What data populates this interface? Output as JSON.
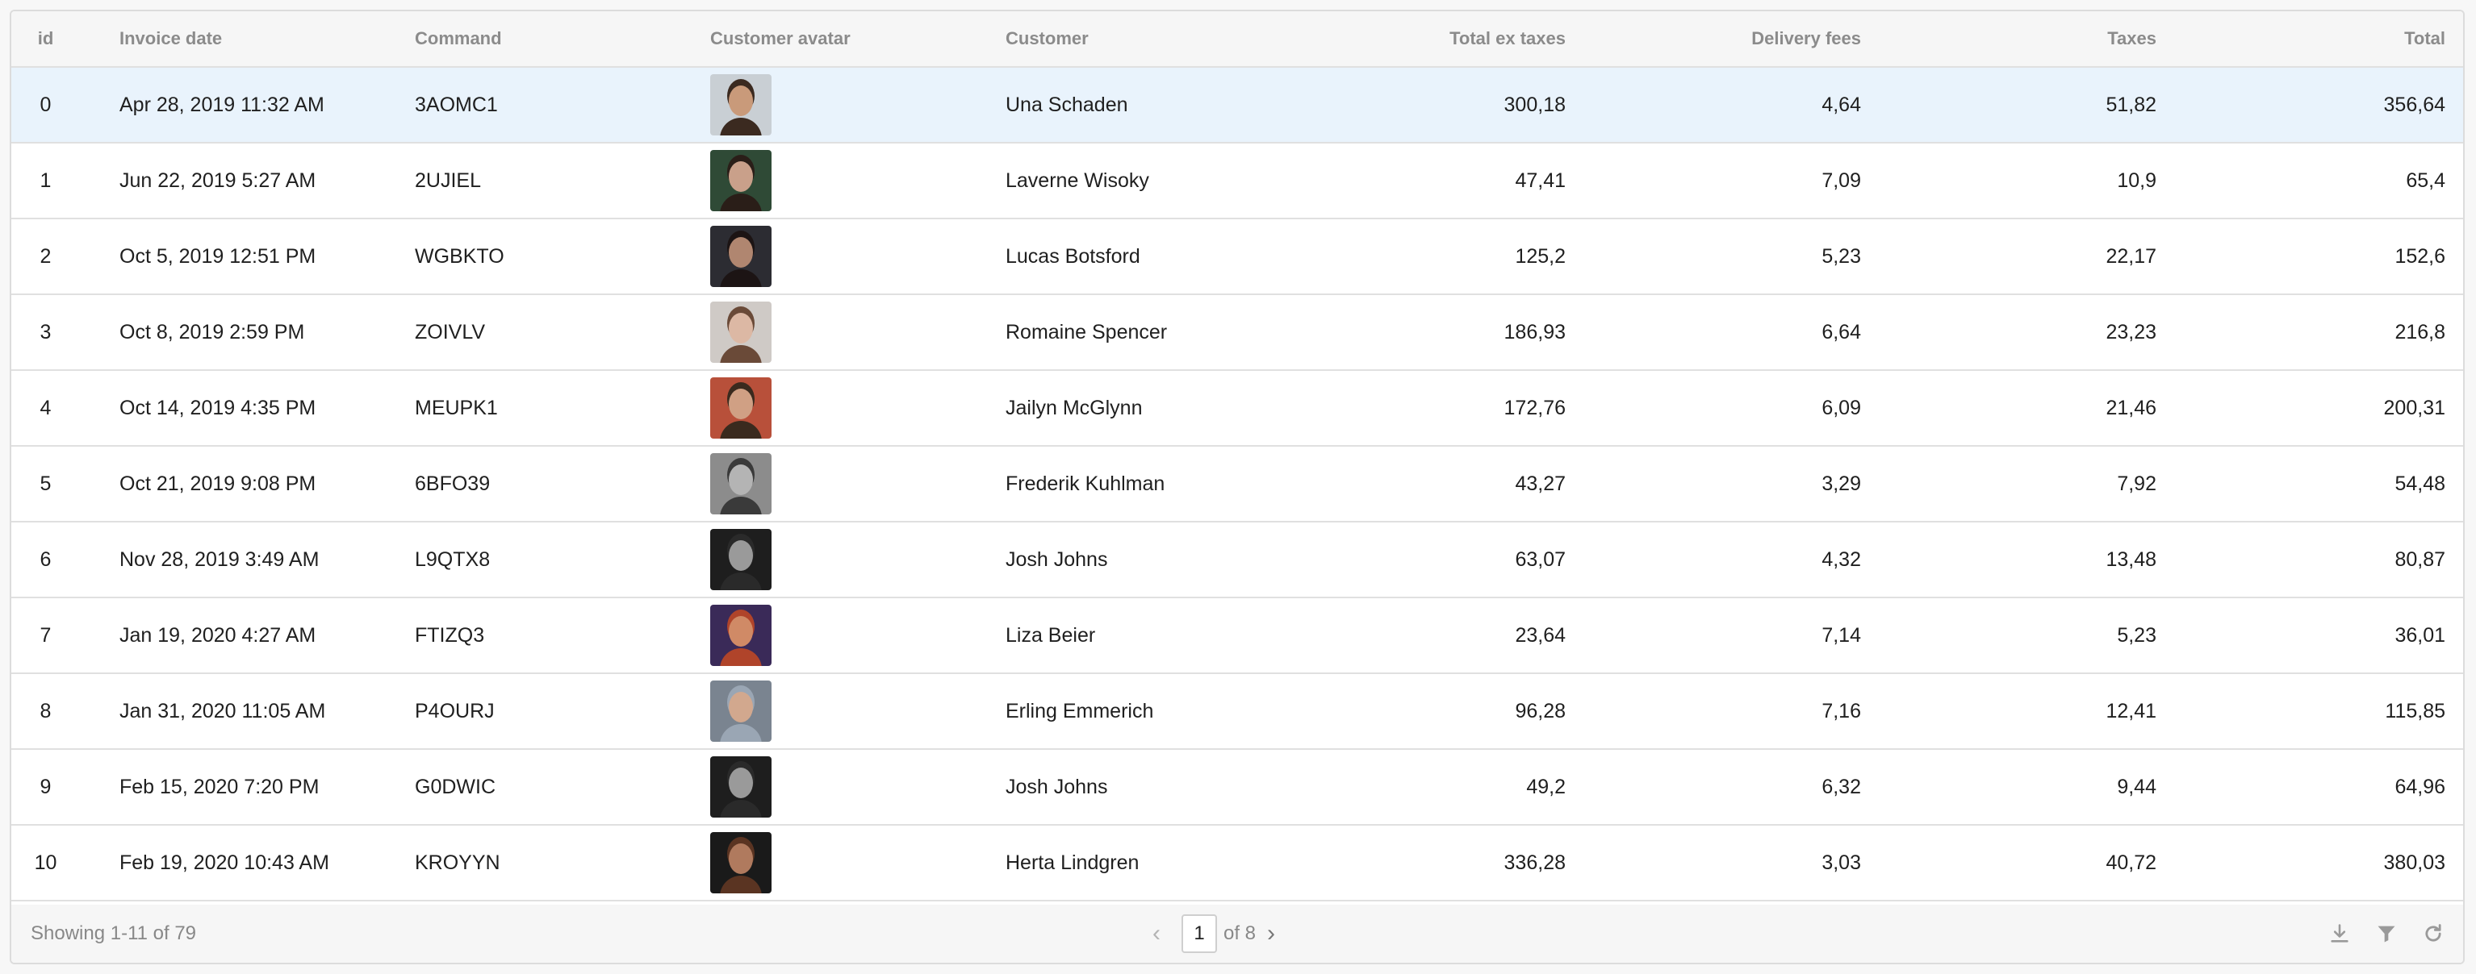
{
  "columns": {
    "id": "id",
    "invoice_date": "Invoice date",
    "command": "Command",
    "avatar": "Customer avatar",
    "customer": "Customer",
    "total_ex_taxes": "Total ex taxes",
    "delivery_fees": "Delivery fees",
    "taxes": "Taxes",
    "total": "Total"
  },
  "rows": [
    {
      "id": "0",
      "date": "Apr 28, 2019 11:32 AM",
      "command": "3AOMC1",
      "customer": "Una Schaden",
      "total_ex_taxes": "300,18",
      "delivery_fees": "4,64",
      "taxes": "51,82",
      "total": "356,64",
      "avatar_bg": "#c9cfd4",
      "avatar_skin": "#c99a7a",
      "avatar_hair": "#3b2a20"
    },
    {
      "id": "1",
      "date": "Jun 22, 2019 5:27 AM",
      "command": "2UJIEL",
      "customer": "Laverne Wisoky",
      "total_ex_taxes": "47,41",
      "delivery_fees": "7,09",
      "taxes": "10,9",
      "total": "65,4",
      "avatar_bg": "#2f4a36",
      "avatar_skin": "#c9a08a",
      "avatar_hair": "#2a1e18"
    },
    {
      "id": "2",
      "date": "Oct 5, 2019 12:51 PM",
      "command": "WGBKTO",
      "customer": "Lucas Botsford",
      "total_ex_taxes": "125,2",
      "delivery_fees": "5,23",
      "taxes": "22,17",
      "total": "152,6",
      "avatar_bg": "#2c2c32",
      "avatar_skin": "#b08670",
      "avatar_hair": "#1c1414"
    },
    {
      "id": "3",
      "date": "Oct 8, 2019 2:59 PM",
      "command": "ZOIVLV",
      "customer": "Romaine Spencer",
      "total_ex_taxes": "186,93",
      "delivery_fees": "6,64",
      "taxes": "23,23",
      "total": "216,8",
      "avatar_bg": "#cfcac6",
      "avatar_skin": "#dcb8a4",
      "avatar_hair": "#6a4a38"
    },
    {
      "id": "4",
      "date": "Oct 14, 2019 4:35 PM",
      "command": "MEUPK1",
      "customer": "Jailyn McGlynn",
      "total_ex_taxes": "172,76",
      "delivery_fees": "6,09",
      "taxes": "21,46",
      "total": "200,31",
      "avatar_bg": "#b8503a",
      "avatar_skin": "#d0a084",
      "avatar_hair": "#3a2a1e"
    },
    {
      "id": "5",
      "date": "Oct 21, 2019 9:08 PM",
      "command": "6BFO39",
      "customer": "Frederik Kuhlman",
      "total_ex_taxes": "43,27",
      "delivery_fees": "3,29",
      "taxes": "7,92",
      "total": "54,48",
      "avatar_bg": "#8c8c8c",
      "avatar_skin": "#b4b4b4",
      "avatar_hair": "#3a3a3a"
    },
    {
      "id": "6",
      "date": "Nov 28, 2019 3:49 AM",
      "command": "L9QTX8",
      "customer": "Josh Johns",
      "total_ex_taxes": "63,07",
      "delivery_fees": "4,32",
      "taxes": "13,48",
      "total": "80,87",
      "avatar_bg": "#1e1e1e",
      "avatar_skin": "#9a9a9a",
      "avatar_hair": "#2a2a2a"
    },
    {
      "id": "7",
      "date": "Jan 19, 2020 4:27 AM",
      "command": "FTIZQ3",
      "customer": "Liza Beier",
      "total_ex_taxes": "23,64",
      "delivery_fees": "7,14",
      "taxes": "5,23",
      "total": "36,01",
      "avatar_bg": "#3a2a58",
      "avatar_skin": "#d08a66",
      "avatar_hair": "#b0442a"
    },
    {
      "id": "8",
      "date": "Jan 31, 2020 11:05 AM",
      "command": "P4OURJ",
      "customer": "Erling Emmerich",
      "total_ex_taxes": "96,28",
      "delivery_fees": "7,16",
      "taxes": "12,41",
      "total": "115,85",
      "avatar_bg": "#7a8490",
      "avatar_skin": "#d2a88e",
      "avatar_hair": "#9aa6b4"
    },
    {
      "id": "9",
      "date": "Feb 15, 2020 7:20 PM",
      "command": "G0DWIC",
      "customer": "Josh Johns",
      "total_ex_taxes": "49,2",
      "delivery_fees": "6,32",
      "taxes": "9,44",
      "total": "64,96",
      "avatar_bg": "#1e1e1e",
      "avatar_skin": "#9a9a9a",
      "avatar_hair": "#2a2a2a"
    },
    {
      "id": "10",
      "date": "Feb 19, 2020 10:43 AM",
      "command": "KROYYN",
      "customer": "Herta Lindgren",
      "total_ex_taxes": "336,28",
      "delivery_fees": "3,03",
      "taxes": "40,72",
      "total": "380,03",
      "avatar_bg": "#1a1a1a",
      "avatar_skin": "#b07a5e",
      "avatar_hair": "#5a3422"
    }
  ],
  "footer": {
    "showing": "Showing 1-11 of 79",
    "page": "1",
    "of_pages": "of 8",
    "prev_icon": "chevron-left-icon",
    "next_icon": "chevron-right-icon",
    "tools": [
      "download-icon",
      "filter-icon",
      "refresh-icon"
    ]
  },
  "colors": {
    "selected_row": "#e9f3fc",
    "header_bg": "#f6f6f6"
  }
}
